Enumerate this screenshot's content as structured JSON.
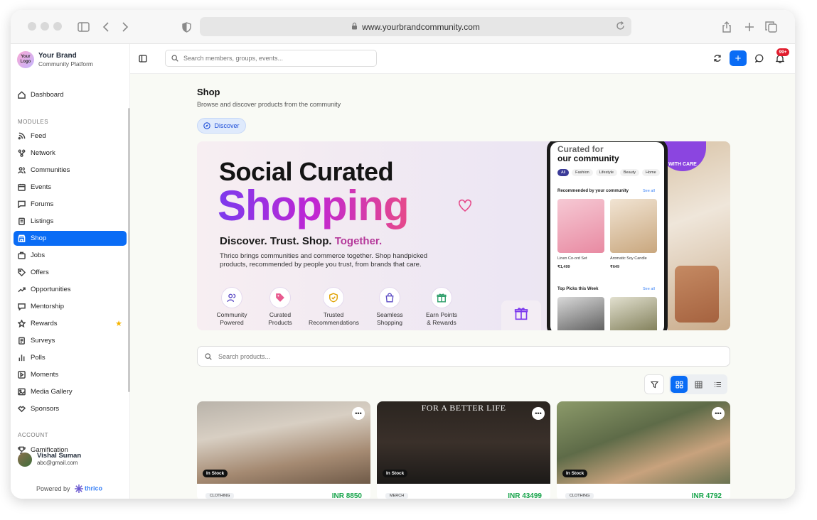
{
  "browser": {
    "url": "www.yourbrandcommunity.com"
  },
  "brand": {
    "logo_text": "Your Logo",
    "name": "Your Brand",
    "subtitle": "Community Platform"
  },
  "sidebar": {
    "dashboard": "Dashboard",
    "modules_header": "MODULES",
    "items": [
      "Feed",
      "Network",
      "Communities",
      "Events",
      "Forums",
      "Listings",
      "Shop",
      "Jobs",
      "Offers",
      "Opportunities",
      "Mentorship",
      "Rewards",
      "Surveys",
      "Polls",
      "Moments",
      "Media Gallery",
      "Sponsors"
    ],
    "account_header": "ACCOUNT",
    "gamification": "Gamification",
    "user": {
      "name": "Vishal Suman",
      "email": "abc@gmail.com"
    },
    "powered_by": "Powered by",
    "powered_brand": "thrico"
  },
  "topbar": {
    "search_placeholder": "Search members, groups, events...",
    "notif_count": "99+"
  },
  "page": {
    "title": "Shop",
    "subtitle": "Browse and discover products from the community",
    "discover": "Discover"
  },
  "banner": {
    "headline1": "Social Curated",
    "headline2": "Shopping",
    "tag_a": "Discover. Trust. Shop.",
    "tag_b": "Together.",
    "desc": "Thrico brings communities and commerce together. Shop handpicked products, recommended by people you trust, from brands that care.",
    "features": [
      {
        "l1": "Community",
        "l2": "Powered"
      },
      {
        "l1": "Curated",
        "l2": "Products"
      },
      {
        "l1": "Trusted",
        "l2": "Recommendations"
      },
      {
        "l1": "Seamless",
        "l2": "Shopping"
      },
      {
        "l1": "Earn Points",
        "l2": "& Rewards"
      }
    ],
    "phone": {
      "title1": "Curated for",
      "title2": "our community",
      "chips": [
        "All",
        "Fashion",
        "Lifestyle",
        "Beauty",
        "Home"
      ],
      "rec_label": "Recommended by your community",
      "see_all": "See all",
      "p1_name": "Linen Co-ord Set",
      "p1_price": "₹1,499",
      "p2_name": "Aromatic Soy Candle",
      "p2_price": "₹649",
      "top_label": "Top Picks this Week"
    },
    "care_badge": "WITH CARE"
  },
  "product_search": {
    "placeholder": "Search products..."
  },
  "products": [
    {
      "stock": "In Stock",
      "category": "CLOTHING",
      "price": "INR 8850"
    },
    {
      "stock": "In Stock",
      "category": "MERCH",
      "price": "INR 43499",
      "overlay": "FOR A BETTER LIFE"
    },
    {
      "stock": "In Stock",
      "category": "CLOTHING",
      "price": "INR 4792"
    }
  ],
  "colors": {
    "accent": "#0a6cf5",
    "price": "#16a34a",
    "badge": "#e11d2e",
    "headline_purple": "#7c3aed"
  }
}
